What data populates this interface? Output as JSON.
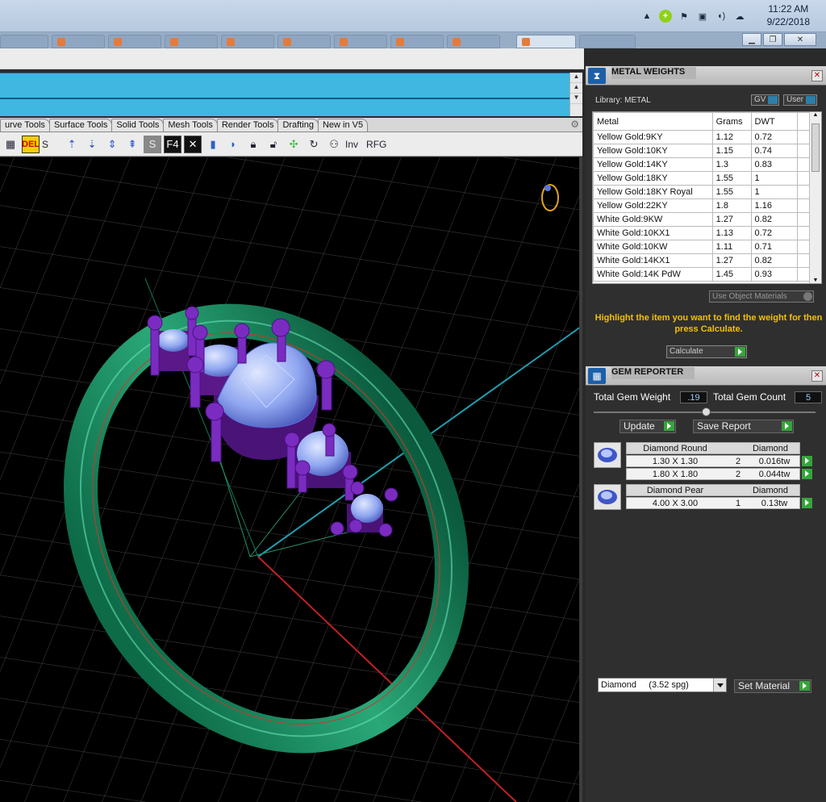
{
  "taskbar": {
    "time": "11:22 AM",
    "date": "9/22/2018",
    "tray_icons": [
      "chevron-up-icon",
      "add-icon",
      "flag-icon",
      "network-icon",
      "speaker-icon",
      "cloud-icon"
    ]
  },
  "toolbar": {
    "tabs": [
      "urve Tools",
      "Surface Tools",
      "Solid Tools",
      "Mesh Tools",
      "Render Tools",
      "Drafting",
      "New in V5"
    ],
    "del_label": "DEL",
    "s_label": "S",
    "f4_label": "F4",
    "inv_label": "Inv",
    "rfg_label": "RFG"
  },
  "metal_weights": {
    "title": "METAL WEIGHTS",
    "library_label": "Library: METAL",
    "gv_label": "GV",
    "user_label": "User",
    "columns": [
      "Metal",
      "Grams",
      "DWT"
    ],
    "rows": [
      {
        "metal": "Yellow Gold:9KY",
        "grams": "1.12",
        "dwt": "0.72"
      },
      {
        "metal": "Yellow Gold:10KY",
        "grams": "1.15",
        "dwt": "0.74"
      },
      {
        "metal": "Yellow Gold:14KY",
        "grams": "1.3",
        "dwt": "0.83"
      },
      {
        "metal": "Yellow Gold:18KY",
        "grams": "1.55",
        "dwt": "1"
      },
      {
        "metal": "Yellow Gold:18KY Royal",
        "grams": "1.55",
        "dwt": "1"
      },
      {
        "metal": "Yellow Gold:22KY",
        "grams": "1.8",
        "dwt": "1.16"
      },
      {
        "metal": "White Gold:9KW",
        "grams": "1.27",
        "dwt": "0.82"
      },
      {
        "metal": "White Gold:10KX1",
        "grams": "1.13",
        "dwt": "0.72"
      },
      {
        "metal": "White Gold:10KW",
        "grams": "1.11",
        "dwt": "0.71"
      },
      {
        "metal": "White Gold:14KX1",
        "grams": "1.27",
        "dwt": "0.82"
      },
      {
        "metal": "White Gold:14K PdW",
        "grams": "1.45",
        "dwt": "0.93"
      }
    ],
    "use_object_label": "Use Object Materials",
    "hint": "Highlight the item you want to find the weight for then press Calculate.",
    "calculate_label": "Calculate"
  },
  "gem_reporter": {
    "title": "GEM REPORTER",
    "total_weight_label": "Total Gem Weight",
    "total_weight_value": ".19",
    "total_count_label": "Total Gem Count",
    "total_count_value": "5",
    "update_label": "Update",
    "save_label": "Save Report",
    "groups": [
      {
        "shape": "Diamond Round",
        "material": "Diamond",
        "rows": [
          {
            "size": "1.30 X 1.30",
            "count": "2",
            "weight": "0.016tw"
          },
          {
            "size": "1.80 X 1.80",
            "count": "2",
            "weight": "0.044tw"
          }
        ]
      },
      {
        "shape": "Diamond Pear",
        "material": "Diamond",
        "rows": [
          {
            "size": "4.00 X 3.00",
            "count": "1",
            "weight": "0.13tw"
          }
        ]
      }
    ],
    "material_select": "Diamond     (3.52 spg)",
    "set_material_label": "Set Material"
  }
}
